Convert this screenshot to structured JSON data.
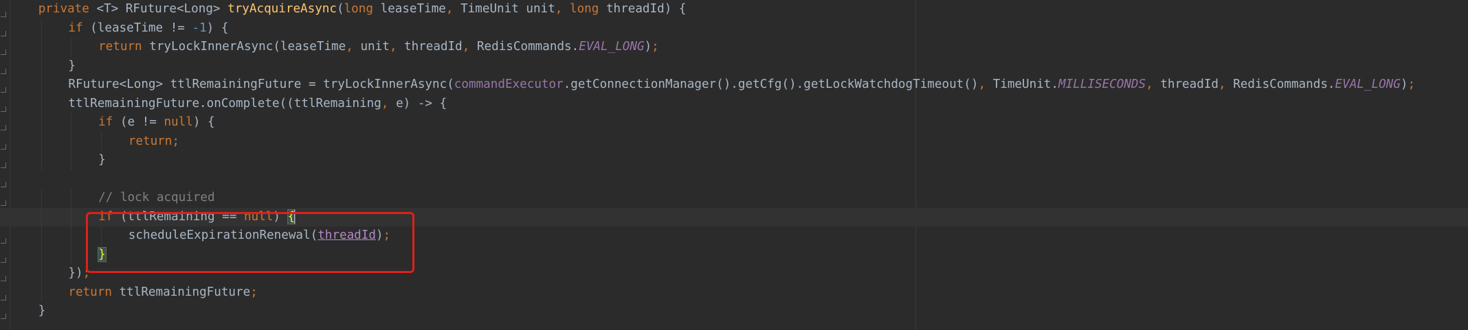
{
  "editor": {
    "lines": [
      {
        "indent": 1,
        "tokens": [
          {
            "t": "private ",
            "c": "kw"
          },
          {
            "t": "<",
            "c": "typ"
          },
          {
            "t": "T",
            "c": "typ"
          },
          {
            "t": "> RFuture<Long> ",
            "c": "typ"
          },
          {
            "t": "tryAcquireAsync",
            "c": "fn"
          },
          {
            "t": "(",
            "c": "typ"
          },
          {
            "t": "long ",
            "c": "kw"
          },
          {
            "t": "leaseTime",
            "c": "typ"
          },
          {
            "t": ", ",
            "c": "kw"
          },
          {
            "t": "TimeUnit unit",
            "c": "typ"
          },
          {
            "t": ", ",
            "c": "kw"
          },
          {
            "t": "long ",
            "c": "kw"
          },
          {
            "t": "threadId) {",
            "c": "typ"
          }
        ]
      },
      {
        "indent": 2,
        "tokens": [
          {
            "t": "if ",
            "c": "kw"
          },
          {
            "t": "(leaseTime != ",
            "c": "typ"
          },
          {
            "t": "-1",
            "c": "num"
          },
          {
            "t": ") {",
            "c": "typ"
          }
        ]
      },
      {
        "indent": 3,
        "tokens": [
          {
            "t": "return ",
            "c": "kw"
          },
          {
            "t": "tryLockInnerAsync(leaseTime",
            "c": "typ"
          },
          {
            "t": ", ",
            "c": "kw"
          },
          {
            "t": "unit",
            "c": "typ"
          },
          {
            "t": ", ",
            "c": "kw"
          },
          {
            "t": "threadId",
            "c": "typ"
          },
          {
            "t": ", ",
            "c": "kw"
          },
          {
            "t": "RedisCommands.",
            "c": "typ"
          },
          {
            "t": "EVAL_LONG",
            "c": "stat"
          },
          {
            "t": ")",
            "c": "typ"
          },
          {
            "t": ";",
            "c": "kw"
          }
        ]
      },
      {
        "indent": 2,
        "tokens": [
          {
            "t": "}",
            "c": "typ"
          }
        ]
      },
      {
        "indent": 2,
        "tokens": [
          {
            "t": "RFuture<Long> ttlRemainingFuture = tryLockInnerAsync(",
            "c": "typ"
          },
          {
            "t": "commandExecutor",
            "c": "field"
          },
          {
            "t": ".getConnectionManager().getCfg().getLockWatchdogTimeout()",
            "c": "typ"
          },
          {
            "t": ", ",
            "c": "kw"
          },
          {
            "t": "TimeUnit.",
            "c": "typ"
          },
          {
            "t": "MILLISECONDS",
            "c": "stat"
          },
          {
            "t": ", ",
            "c": "kw"
          },
          {
            "t": "threadId",
            "c": "typ"
          },
          {
            "t": ", ",
            "c": "kw"
          },
          {
            "t": "RedisCommands.",
            "c": "typ"
          },
          {
            "t": "EVAL_LONG",
            "c": "stat"
          },
          {
            "t": ")",
            "c": "typ"
          },
          {
            "t": ";",
            "c": "kw"
          }
        ]
      },
      {
        "indent": 2,
        "tokens": [
          {
            "t": "ttlRemainingFuture.onComplete((ttlRemaining",
            "c": "typ"
          },
          {
            "t": ", ",
            "c": "kw"
          },
          {
            "t": "e) -> {",
            "c": "typ"
          }
        ]
      },
      {
        "indent": 3,
        "tokens": [
          {
            "t": "if ",
            "c": "kw"
          },
          {
            "t": "(e != ",
            "c": "typ"
          },
          {
            "t": "null",
            "c": "kw"
          },
          {
            "t": ") {",
            "c": "typ"
          }
        ]
      },
      {
        "indent": 4,
        "tokens": [
          {
            "t": "return;",
            "c": "kw"
          }
        ]
      },
      {
        "indent": 3,
        "tokens": [
          {
            "t": "}",
            "c": "typ"
          }
        ]
      },
      {
        "indent": 0,
        "tokens": []
      },
      {
        "indent": 3,
        "tokens": [
          {
            "t": "// lock acquired",
            "c": "cm"
          }
        ]
      },
      {
        "indent": 3,
        "current": true,
        "tokens": [
          {
            "t": "if ",
            "c": "kw"
          },
          {
            "t": "(ttlRemaining == ",
            "c": "typ"
          },
          {
            "t": "null",
            "c": "kw"
          },
          {
            "t": ") ",
            "c": "typ"
          },
          {
            "t": "{",
            "c": "brace-hl"
          },
          {
            "t": "",
            "c": "caret"
          }
        ]
      },
      {
        "indent": 4,
        "tokens": [
          {
            "t": "scheduleExpirationRenewal(",
            "c": "typ"
          },
          {
            "t": "threadId",
            "c": "param"
          },
          {
            "t": ")",
            "c": "typ"
          },
          {
            "t": ";",
            "c": "kw"
          }
        ]
      },
      {
        "indent": 3,
        "tokens": [
          {
            "t": "}",
            "c": "brace-hl"
          }
        ]
      },
      {
        "indent": 2,
        "tokens": [
          {
            "t": "})",
            "c": "typ"
          },
          {
            "t": ";",
            "c": "kw"
          }
        ]
      },
      {
        "indent": 2,
        "tokens": [
          {
            "t": "return ",
            "c": "kw"
          },
          {
            "t": "ttlRemainingFuture",
            "c": "typ"
          },
          {
            "t": ";",
            "c": "kw"
          }
        ]
      },
      {
        "indent": 1,
        "tokens": [
          {
            "t": "}",
            "c": "typ"
          }
        ]
      }
    ]
  },
  "annotation": {
    "color": "#e0201a",
    "description_target": "highlighted-block"
  },
  "colors": {
    "background": "#2b2b2b",
    "keyword": "#cc7832",
    "function": "#ffc66d",
    "number": "#6897bb",
    "static_field": "#9876aa",
    "comment": "#808080",
    "default_text": "#a9b7c6"
  }
}
